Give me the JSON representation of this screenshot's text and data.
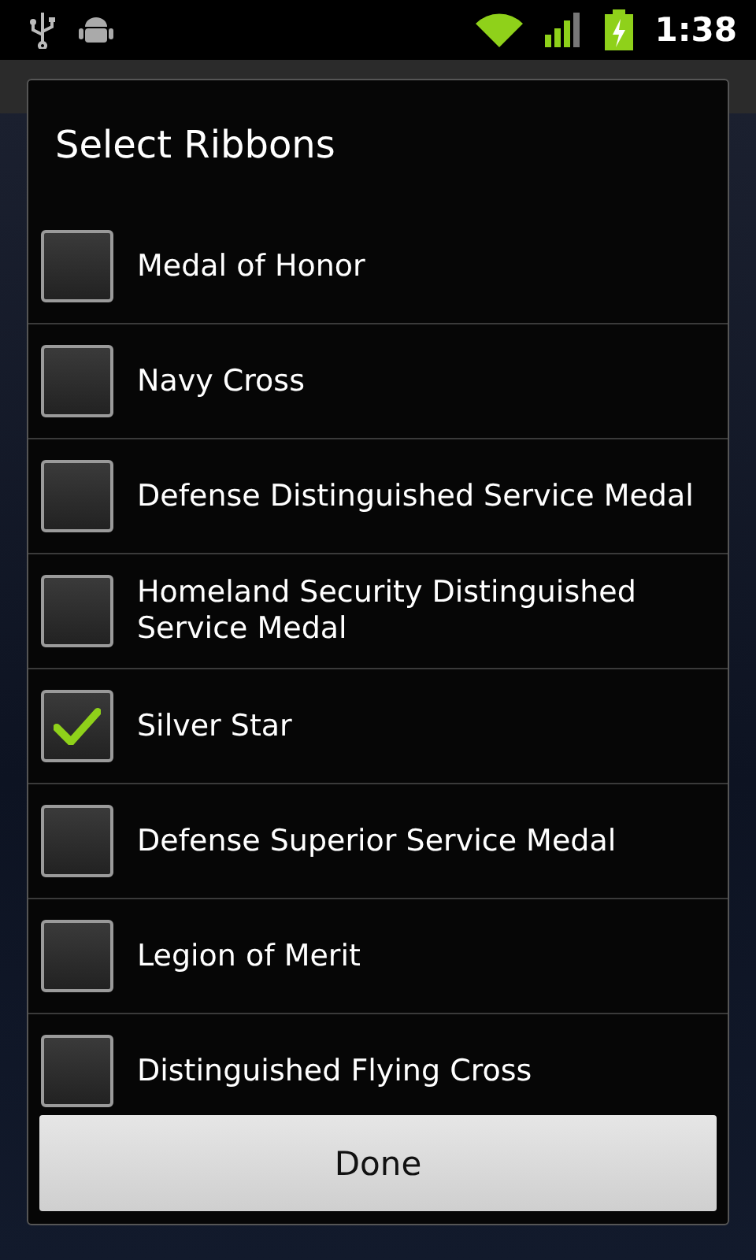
{
  "status_bar": {
    "time": "1:38"
  },
  "dialog": {
    "title": "Select Ribbons",
    "items": [
      {
        "label": "Medal of Honor",
        "checked": false
      },
      {
        "label": "Navy Cross",
        "checked": false
      },
      {
        "label": "Defense Distinguished Service Medal",
        "checked": false
      },
      {
        "label": "Homeland Security Distinguished Service Medal",
        "checked": false
      },
      {
        "label": "Silver Star",
        "checked": true
      },
      {
        "label": "Defense Superior Service Medal",
        "checked": false
      },
      {
        "label": "Legion of Merit",
        "checked": false
      },
      {
        "label": "Distinguished Flying Cross",
        "checked": false
      }
    ],
    "button": "Done"
  }
}
